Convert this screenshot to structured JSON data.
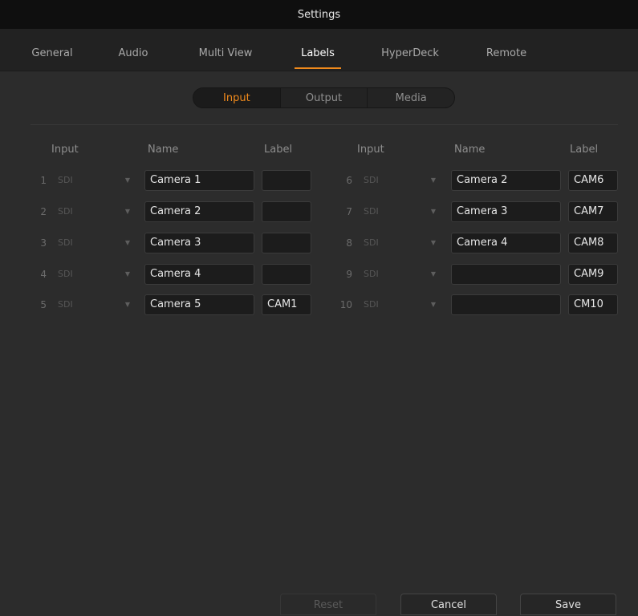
{
  "window": {
    "title": "Settings"
  },
  "tabs": [
    {
      "label": "General"
    },
    {
      "label": "Audio"
    },
    {
      "label": "Multi View"
    },
    {
      "label": "Labels",
      "active": true
    },
    {
      "label": "HyperDeck"
    },
    {
      "label": "Remote"
    }
  ],
  "segmented": {
    "items": [
      "Input",
      "Output",
      "Media"
    ],
    "selected": "Input"
  },
  "columns": {
    "left": {
      "input": "Input",
      "name": "Name",
      "label": "Label"
    },
    "right": {
      "input": "Input",
      "name": "Name",
      "label": "Label"
    }
  },
  "rows_left": [
    {
      "num": "1",
      "source": "SDI",
      "name": "Camera 1",
      "label": ""
    },
    {
      "num": "2",
      "source": "SDI",
      "name": "Camera 2",
      "label": ""
    },
    {
      "num": "3",
      "source": "SDI",
      "name": "Camera 3",
      "label": ""
    },
    {
      "num": "4",
      "source": "SDI",
      "name": "Camera 4",
      "label": ""
    },
    {
      "num": "5",
      "source": "SDI",
      "name": "Camera 5",
      "label": "CAM1"
    }
  ],
  "rows_right": [
    {
      "num": "6",
      "source": "SDI",
      "name": "Camera 2",
      "label": "CAM6"
    },
    {
      "num": "7",
      "source": "SDI",
      "name": "Camera 3",
      "label": "CAM7"
    },
    {
      "num": "8",
      "source": "SDI",
      "name": "Camera 4",
      "label": "CAM8"
    },
    {
      "num": "9",
      "source": "SDI",
      "name": "",
      "label": "CAM9"
    },
    {
      "num": "10",
      "source": "SDI",
      "name": "",
      "label": "CM10"
    }
  ],
  "buttons": {
    "reset": "Reset",
    "cancel": "Cancel",
    "save": "Save"
  },
  "colors": {
    "accent": "#f08a1c",
    "background": "#2c2c2c",
    "titlebar": "#0f0f0f"
  }
}
